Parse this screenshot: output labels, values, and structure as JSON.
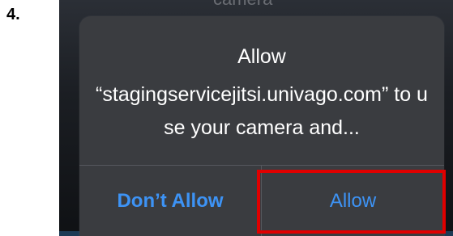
{
  "step": {
    "number": "4."
  },
  "background": {
    "partial_text": "camera"
  },
  "dialog": {
    "title": "Allow",
    "message": "“stagingservicejitsi.univago.com” to use your camera and...",
    "deny_label": "Don’t Allow",
    "allow_label": "Allow"
  },
  "colors": {
    "dialog_bg": "#3a3c40",
    "button_text": "#3d93f5",
    "highlight": "#e00000"
  }
}
